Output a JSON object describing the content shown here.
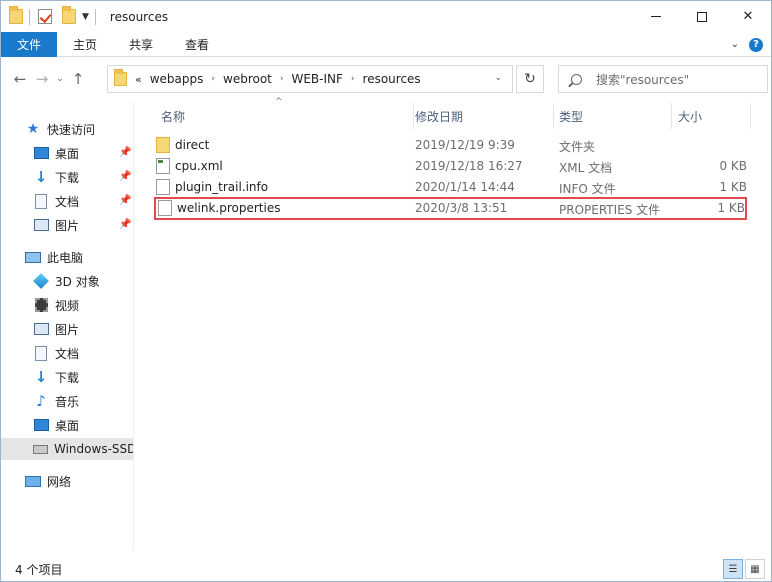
{
  "window": {
    "title": "resources"
  },
  "ribbon": {
    "tabs": [
      "文件",
      "主页",
      "共享",
      "查看"
    ]
  },
  "address": {
    "overflow": "«",
    "crumbs": [
      "webapps",
      "webroot",
      "WEB-INF",
      "resources"
    ]
  },
  "search": {
    "placeholder": "搜索\"resources\""
  },
  "sidebar": {
    "quick_access": "快速访问",
    "quick_items": [
      "桌面",
      "下载",
      "文档",
      "图片"
    ],
    "this_pc": "此电脑",
    "pc_items": [
      "3D 对象",
      "视频",
      "图片",
      "文档",
      "下载",
      "音乐",
      "桌面",
      "Windows-SSD"
    ],
    "network": "网络"
  },
  "columns": {
    "name": "名称",
    "date": "修改日期",
    "type": "类型",
    "size": "大小"
  },
  "files": [
    {
      "name": "direct",
      "date": "2019/12/19 9:39",
      "type": "文件夹",
      "size": "",
      "icon": "folder-icon"
    },
    {
      "name": "cpu.xml",
      "date": "2019/12/18 16:27",
      "type": "XML 文档",
      "size": "0 KB",
      "icon": "xml-file-icon"
    },
    {
      "name": "plugin_trail.info",
      "date": "2020/1/14 14:44",
      "type": "INFO 文件",
      "size": "1 KB",
      "icon": "file-icon"
    },
    {
      "name": "welink.properties",
      "date": "2020/3/8 13:51",
      "type": "PROPERTIES 文件",
      "size": "1 KB",
      "icon": "file-icon",
      "highlighted": true
    }
  ],
  "status": {
    "count": "4 个项目"
  },
  "colors": {
    "file_tab": "#1979ca",
    "highlight_border": "#e04a4a",
    "selected_nav": "#e5e5e5"
  }
}
